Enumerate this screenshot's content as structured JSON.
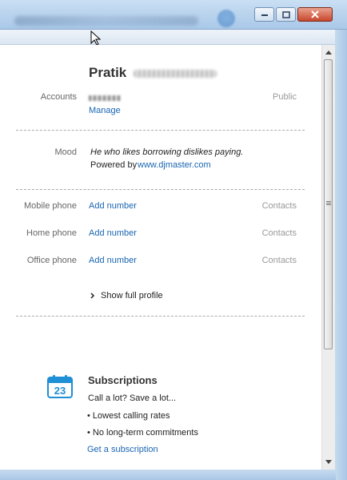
{
  "window": {
    "controls": {
      "minimize_icon": "minimize-icon",
      "maximize_icon": "maximize-icon",
      "close_icon": "close-icon"
    }
  },
  "profile": {
    "first_name": "Pratik",
    "accounts_label": "Accounts",
    "accounts_visibility": "Public",
    "manage_link": "Manage",
    "mood_label": "Mood",
    "mood_text": "He who likes borrowing dislikes paying.",
    "powered_by_text": "Powered by",
    "powered_by_link": "www.djmaster.com"
  },
  "phones": [
    {
      "label": "Mobile phone",
      "action": "Add number",
      "visibility": "Contacts"
    },
    {
      "label": "Home phone",
      "action": "Add number",
      "visibility": "Contacts"
    },
    {
      "label": "Office phone",
      "action": "Add number",
      "visibility": "Contacts"
    }
  ],
  "show_full_profile": "Show full profile",
  "subscriptions": {
    "icon": "calendar-icon",
    "icon_number": "23",
    "title": "Subscriptions",
    "tagline": "Call a lot? Save a lot...",
    "bullets": [
      "Lowest calling rates",
      "No long-term commitments"
    ],
    "cta": "Get a subscription"
  },
  "colors": {
    "link": "#1a66b3",
    "accent_icon": "#1f8fd6"
  }
}
